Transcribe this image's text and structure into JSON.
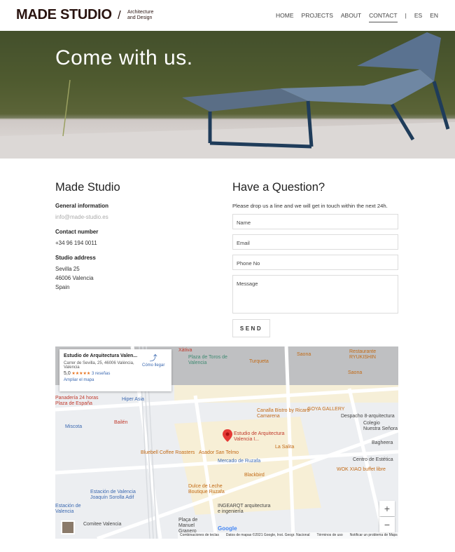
{
  "header": {
    "logo": "MADE STUDIO",
    "slash": "/",
    "tagline1": "Architecture",
    "tagline2": "and Design",
    "nav": [
      {
        "label": "HOME"
      },
      {
        "label": "PROJECTS"
      },
      {
        "label": "ABOUT"
      },
      {
        "label": "CONTACT",
        "active": true
      },
      {
        "label": "|"
      },
      {
        "label": "ES"
      },
      {
        "label": "EN"
      }
    ]
  },
  "hero": {
    "title": "Come with us."
  },
  "info": {
    "title": "Made Studio",
    "general_label": "General information",
    "email": "info@made-studio.es",
    "contact_label": "Contact number",
    "phone": "+34 96 194 0011",
    "address_label": "Studio address",
    "address": [
      "Sevilla 25",
      "46006 Valencia",
      "Spain"
    ]
  },
  "form": {
    "title": "Have a Question?",
    "intro": "Please drop us a line and we will get in touch within the next 24h.",
    "name": "Name",
    "email": "Email",
    "phone": "Phone No",
    "message": "Message",
    "send": "SEND"
  },
  "map": {
    "card": {
      "title": "Estudio de Arquitectura Valen...",
      "address": "Carrer de Sevilla, 25, 46006 València, Valencia",
      "rating": "5,0",
      "stars": "★★★★★",
      "reviews": "3 reseñas",
      "directions": "Cómo llegar",
      "enlarge": "Ampliar el mapa"
    },
    "labels": [
      "Xàtiva",
      "Plaza de Toros de Valencia",
      "Turqueta",
      "Saona",
      "Restaurante RYUKISHIN",
      "Saona",
      "Hiper Asia",
      "Miscota",
      "Bailén",
      "Canalla Bistro by Ricard Camarena",
      "GOYA GALLERY",
      "Despacho 8-arquitectura",
      "Colegio Nuestra Señora",
      "Estudio de Arquitectura Valencia I...",
      "La Salita",
      "Bluebell Coffee Roasters",
      "Asador San Telmo",
      "Mercado de Ruzafa",
      "Bagheera",
      "Blackbird",
      "Centro de Estética",
      "WOK XIAO buffet libre",
      "Dulce de Leche Boutique Ruzafa",
      "Estación de Valencia Joaquín Sorolla Adif",
      "Estación de Valencia",
      "INGEARQT arquitectura e ingeniería",
      "Plaça de Manuel Granero",
      "Comitee Valencia",
      "Panadería 24 horas",
      "Plaza de España"
    ],
    "footer": [
      "Combinaciones de teclas",
      "Datos de mapas ©2021 Google, Inst. Geogr. Nacional",
      "Términos de uso",
      "Notificar un problema de Maps"
    ],
    "google": "Google",
    "zoom_in": "+",
    "zoom_out": "−"
  }
}
